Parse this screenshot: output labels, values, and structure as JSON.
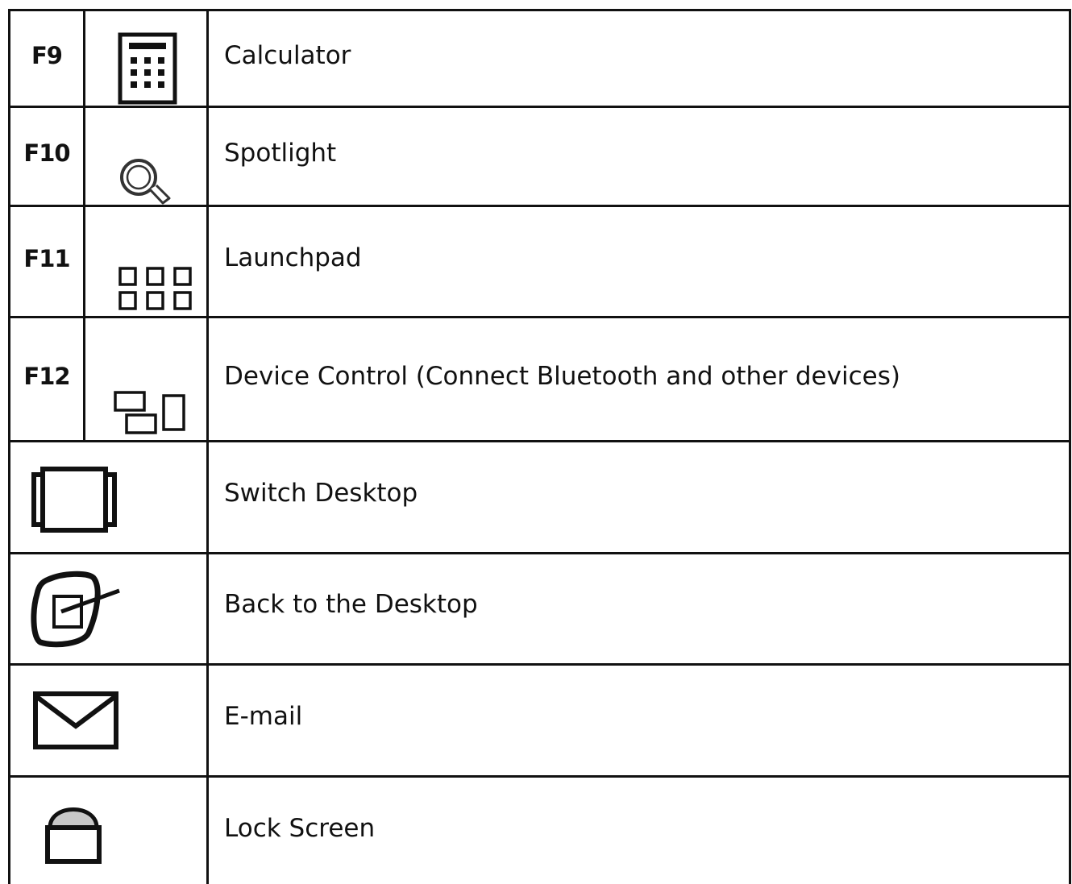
{
  "rows": [
    {
      "key": "F9",
      "icon": "calculator-icon",
      "label": "Calculator"
    },
    {
      "key": "F10",
      "icon": "magnifier-icon",
      "label": "Spotlight"
    },
    {
      "key": "F11",
      "icon": "launchpad-grid-icon",
      "label": "Launchpad"
    },
    {
      "key": "F12",
      "icon": "device-control-icon",
      "label": "Device Control (Connect Bluetooth and other devices)"
    },
    {
      "key": "",
      "icon": "switch-desktop-icon",
      "label": "Switch Desktop"
    },
    {
      "key": "",
      "icon": "back-to-desktop-icon",
      "label": "Back to the Desktop"
    },
    {
      "key": "",
      "icon": "envelope-icon",
      "label": "E-mail"
    },
    {
      "key": "",
      "icon": "padlock-icon",
      "label": "Lock Screen"
    }
  ]
}
